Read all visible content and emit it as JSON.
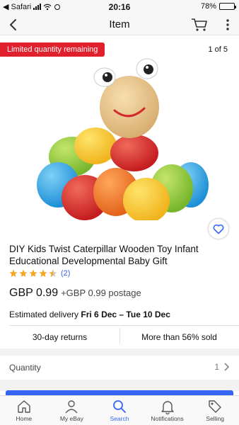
{
  "status_bar": {
    "carrier": "◀ Safari",
    "time": "20:16",
    "battery": "78%",
    "battery_level": 0.78
  },
  "nav": {
    "title": "Item"
  },
  "gallery": {
    "badge": "Limited quantity remaining",
    "counter": "1 of 5"
  },
  "listing": {
    "title": "DIY Kids Twist Caterpillar Wooden Toy Infant Educational Developmental Baby Gift",
    "rating": 4.5,
    "rating_count": "(2)",
    "price": "GBP  0.99",
    "postage": "+GBP  0.99 postage",
    "delivery_label": "Estimated delivery",
    "delivery_dates": "Fri 6 Dec – Tue 10 Dec",
    "returns": "30-day returns",
    "sold": "More than 56% sold",
    "quantity_label": "Quantity",
    "quantity_value": "1"
  },
  "colors": {
    "accent": "#3665f3",
    "badge_red": "#e0202c",
    "star": "#f5a623"
  },
  "tabs": [
    {
      "label": "Home",
      "icon": "home-icon"
    },
    {
      "label": "My eBay",
      "icon": "person-icon"
    },
    {
      "label": "Search",
      "icon": "search-icon"
    },
    {
      "label": "Notifications",
      "icon": "bell-icon"
    },
    {
      "label": "Selling",
      "icon": "tag-icon"
    }
  ]
}
